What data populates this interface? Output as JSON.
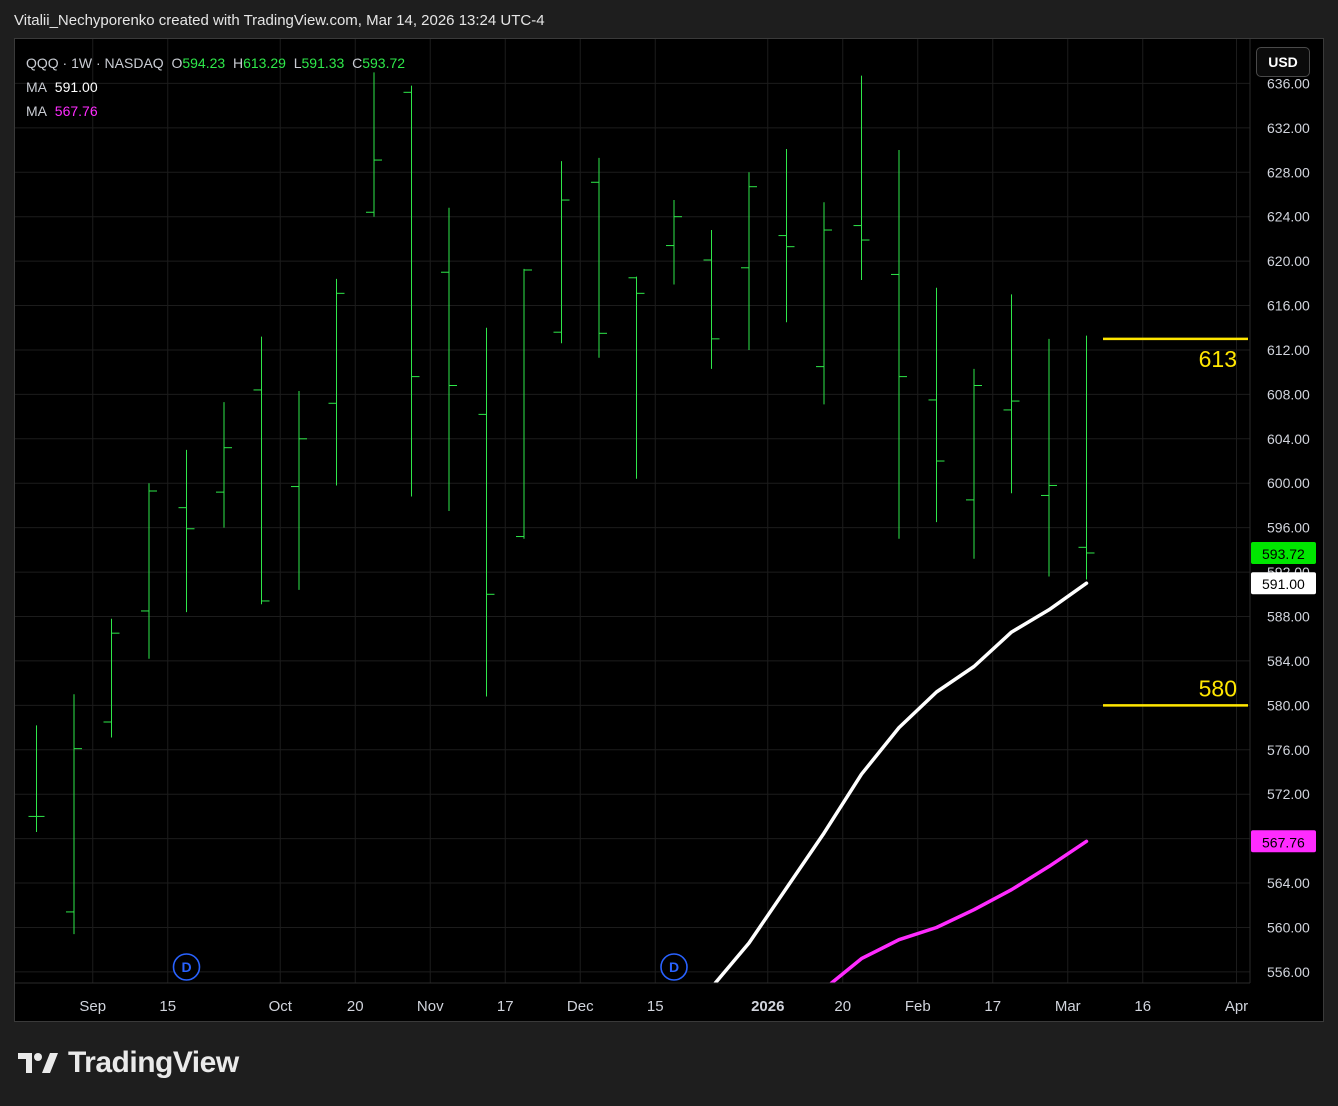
{
  "header": {
    "snapshot_text": "Vitalii_Nechyporenko created with TradingView.com, Mar 14, 2026 13:24 UTC-4"
  },
  "legend": {
    "symbol": "QQQ · 1W · NASDAQ",
    "o_label": "O",
    "o_value": "594.23",
    "h_label": "H",
    "h_value": "613.29",
    "l_label": "L",
    "l_value": "591.33",
    "c_label": "C",
    "c_value": "593.72",
    "ma1_label": "MA",
    "ma1_value": "591.00",
    "ma2_label": "MA",
    "ma2_value": "567.76"
  },
  "currency_button": "USD",
  "brand": {
    "name": "TradingView",
    "icon": "tradingview-logo-icon"
  },
  "colors": {
    "background": "#000000",
    "bar": "#2ee84a",
    "ma1": "#ffffff",
    "ma2": "#ff2bff",
    "level": "#ffe600",
    "grid": "#1c1c1c",
    "dividend_marker": "#2962ff"
  },
  "chart_data": {
    "type": "ohlc",
    "interval": "1W",
    "y_range": [
      555,
      640
    ],
    "y_ticks": [
      "636.00",
      "632.00",
      "628.00",
      "624.00",
      "620.00",
      "616.00",
      "612.00",
      "608.00",
      "604.00",
      "600.00",
      "596.00",
      "592.00",
      "588.00",
      "584.00",
      "580.00",
      "576.00",
      "572.00",
      "568.00",
      "564.00",
      "560.00",
      "556.00"
    ],
    "x_ticks": [
      {
        "label": "Sep",
        "at": 1.5
      },
      {
        "label": "15",
        "at": 3.5
      },
      {
        "label": "Oct",
        "at": 6.5
      },
      {
        "label": "20",
        "at": 8.5
      },
      {
        "label": "Nov",
        "at": 10.5
      },
      {
        "label": "17",
        "at": 12.5
      },
      {
        "label": "Dec",
        "at": 14.5
      },
      {
        "label": "15",
        "at": 16.5
      },
      {
        "label": "2026",
        "at": 19.5
      },
      {
        "label": "20",
        "at": 21.5
      },
      {
        "label": "Feb",
        "at": 23.5
      },
      {
        "label": "17",
        "at": 25.5
      },
      {
        "label": "Mar",
        "at": 27.5
      },
      {
        "label": "16",
        "at": 29.5
      },
      {
        "label": "Apr",
        "at": 32.0
      }
    ],
    "bars": [
      {
        "o": 570.0,
        "h": 578.2,
        "l": 568.6,
        "c": 570.0
      },
      {
        "o": 561.4,
        "h": 581.0,
        "l": 559.4,
        "c": 576.1
      },
      {
        "o": 578.5,
        "h": 587.8,
        "l": 577.1,
        "c": 586.5
      },
      {
        "o": 588.5,
        "h": 600.0,
        "l": 584.2,
        "c": 599.3
      },
      {
        "o": 597.8,
        "h": 603.0,
        "l": 588.4,
        "c": 595.9
      },
      {
        "o": 599.2,
        "h": 607.3,
        "l": 596.0,
        "c": 603.2
      },
      {
        "o": 608.4,
        "h": 613.2,
        "l": 589.1,
        "c": 589.4
      },
      {
        "o": 599.7,
        "h": 608.3,
        "l": 590.4,
        "c": 604.0
      },
      {
        "o": 607.2,
        "h": 618.4,
        "l": 599.8,
        "c": 617.1
      },
      {
        "o": 624.4,
        "h": 637.0,
        "l": 624.0,
        "c": 629.1
      },
      {
        "o": 635.2,
        "h": 635.8,
        "l": 598.8,
        "c": 609.6
      },
      {
        "o": 619.0,
        "h": 624.8,
        "l": 597.5,
        "c": 608.8
      },
      {
        "o": 606.2,
        "h": 614.0,
        "l": 580.8,
        "c": 590.0
      },
      {
        "o": 595.2,
        "h": 619.3,
        "l": 595.0,
        "c": 619.2
      },
      {
        "o": 613.6,
        "h": 629.0,
        "l": 612.6,
        "c": 625.5
      },
      {
        "o": 627.1,
        "h": 629.3,
        "l": 611.3,
        "c": 613.5
      },
      {
        "o": 618.5,
        "h": 618.6,
        "l": 600.4,
        "c": 617.1
      },
      {
        "o": 621.4,
        "h": 625.5,
        "l": 617.9,
        "c": 624.0
      },
      {
        "o": 620.1,
        "h": 622.8,
        "l": 610.3,
        "c": 613.0
      },
      {
        "o": 619.4,
        "h": 628.0,
        "l": 612.0,
        "c": 626.7
      },
      {
        "o": 622.3,
        "h": 630.1,
        "l": 614.5,
        "c": 621.3
      },
      {
        "o": 610.5,
        "h": 625.3,
        "l": 607.1,
        "c": 622.8
      },
      {
        "o": 623.2,
        "h": 636.7,
        "l": 618.3,
        "c": 621.9
      },
      {
        "o": 618.8,
        "h": 630.0,
        "l": 595.0,
        "c": 609.6
      },
      {
        "o": 607.5,
        "h": 617.6,
        "l": 596.5,
        "c": 602.0
      },
      {
        "o": 598.5,
        "h": 610.3,
        "l": 593.2,
        "c": 608.8
      },
      {
        "o": 606.6,
        "h": 617.0,
        "l": 599.1,
        "c": 607.4
      },
      {
        "o": 598.9,
        "h": 613.0,
        "l": 591.6,
        "c": 599.8
      },
      {
        "o": 594.23,
        "h": 613.29,
        "l": 591.33,
        "c": 593.72
      }
    ],
    "series": [
      {
        "values": [
          [
            18.1,
            555.0
          ],
          [
            19.0,
            558.6
          ],
          [
            21.0,
            568.5
          ],
          [
            22.0,
            573.8
          ],
          [
            23.0,
            578.0
          ],
          [
            24.0,
            581.2
          ],
          [
            25.0,
            583.5
          ],
          [
            26.0,
            586.6
          ],
          [
            27.0,
            588.6
          ],
          [
            28.0,
            591.0
          ]
        ]
      },
      {
        "values": [
          [
            21.2,
            555.0
          ],
          [
            22.0,
            557.2
          ],
          [
            23.0,
            558.9
          ],
          [
            24.0,
            560.0
          ],
          [
            25.0,
            561.6
          ],
          [
            26.0,
            563.4
          ],
          [
            27.0,
            565.5
          ],
          [
            28.0,
            567.76
          ]
        ]
      }
    ],
    "price_labels": [
      {
        "text": "593.72",
        "y": 593.72,
        "bg": "#00e600",
        "fg": "#000000"
      },
      {
        "text": "591.00",
        "y": 591.0,
        "bg": "#ffffff",
        "fg": "#000000"
      },
      {
        "text": "567.76",
        "y": 567.76,
        "bg": "#ff2bff",
        "fg": "#000000"
      }
    ],
    "levels": [
      {
        "value": 613,
        "label": "613"
      },
      {
        "value": 580,
        "label": "580"
      }
    ],
    "events": [
      {
        "label": "D",
        "at": 4.0
      },
      {
        "label": "D",
        "at": 17.0
      }
    ]
  }
}
